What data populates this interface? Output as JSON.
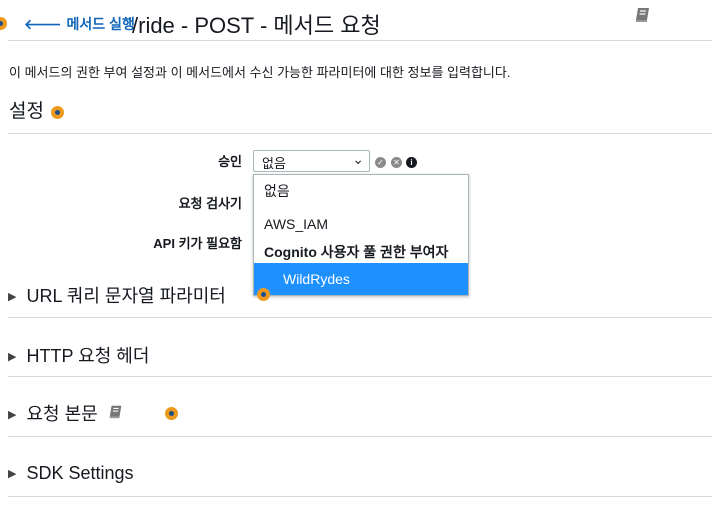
{
  "header": {
    "back_label": "메서드 실행",
    "title": "/ride - POST - 메서드 요청"
  },
  "description": "이 메서드의 권한 부여 설정과 이 메서드에서 수신 가능한 파라미터에 대한 정보를 입력합니다.",
  "settings": {
    "title": "설정",
    "fields": {
      "authorization_label": "승인",
      "authorization_value": "없음",
      "validator_label": "요청 검사기",
      "api_key_label": "API 키가 필요함"
    }
  },
  "dropdown": {
    "options": [
      {
        "label": "없음",
        "kind": "option"
      },
      {
        "label": "AWS_IAM",
        "kind": "option"
      },
      {
        "label": "Cognito 사용자 풀 권한 부여자",
        "kind": "group"
      },
      {
        "label": "WildRydes",
        "kind": "selected"
      }
    ]
  },
  "sections": [
    {
      "label": "URL 쿼리 문자열 파라미터"
    },
    {
      "label": "HTTP 요청 헤더"
    },
    {
      "label": "요청 본문"
    },
    {
      "label": "SDK Settings"
    }
  ],
  "colors": {
    "link": "#1166bb",
    "accent_orange": "#ec9a1e",
    "selected_bg": "#1e90ff",
    "divider": "#d5dbdb"
  },
  "icons": [
    "arrow-left-icon",
    "book-icon",
    "info-dot-icon",
    "check-icon",
    "remove-icon",
    "info-icon",
    "caret-down-icon",
    "triangle-right-icon"
  ]
}
